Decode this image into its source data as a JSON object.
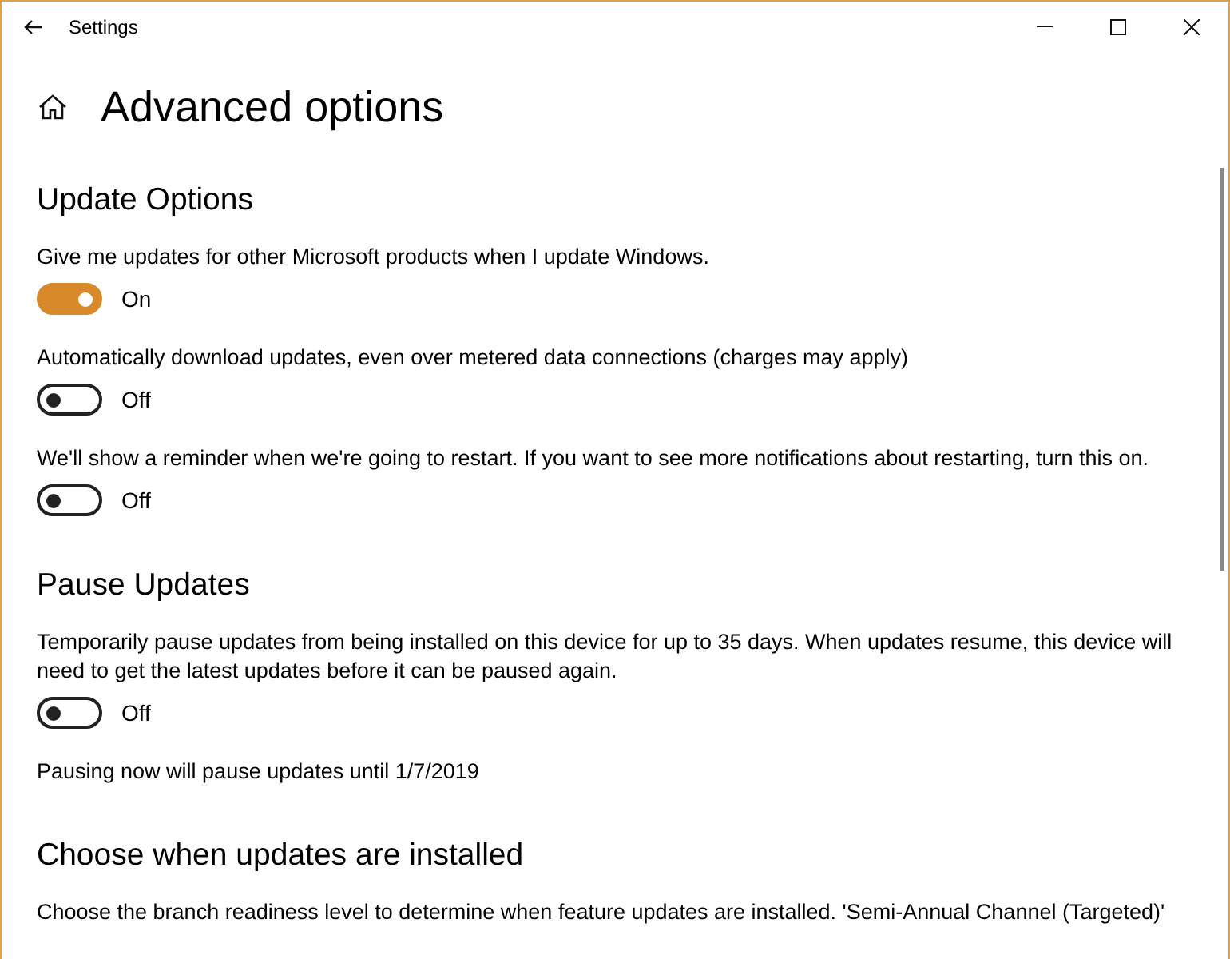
{
  "window": {
    "title": "Settings"
  },
  "page": {
    "title": "Advanced options"
  },
  "sections": [
    {
      "heading": "Update Options",
      "items": [
        {
          "kind": "toggle",
          "label": "Give me updates for other Microsoft products when I update Windows.",
          "on": true,
          "state_text": "On"
        },
        {
          "kind": "toggle",
          "label": "Automatically download updates, even over metered data connections (charges may apply)",
          "on": false,
          "state_text": "Off"
        },
        {
          "kind": "toggle",
          "label": "We'll show a reminder when we're going to restart. If you want to see more notifications about restarting, turn this on.",
          "on": false,
          "state_text": "Off"
        }
      ]
    },
    {
      "heading": "Pause Updates",
      "items": [
        {
          "kind": "toggle",
          "label": "Temporarily pause updates from being installed on this device for up to 35 days. When updates resume, this device will need to get the latest updates before it can be paused again.",
          "on": false,
          "state_text": "Off"
        },
        {
          "kind": "text",
          "label": "Pausing now will pause updates until 1/7/2019"
        }
      ]
    },
    {
      "heading": "Choose when updates are installed",
      "items": [
        {
          "kind": "text",
          "label": "Choose the branch readiness level to determine when feature updates are installed. 'Semi-Annual Channel (Targeted)'"
        }
      ]
    }
  ]
}
